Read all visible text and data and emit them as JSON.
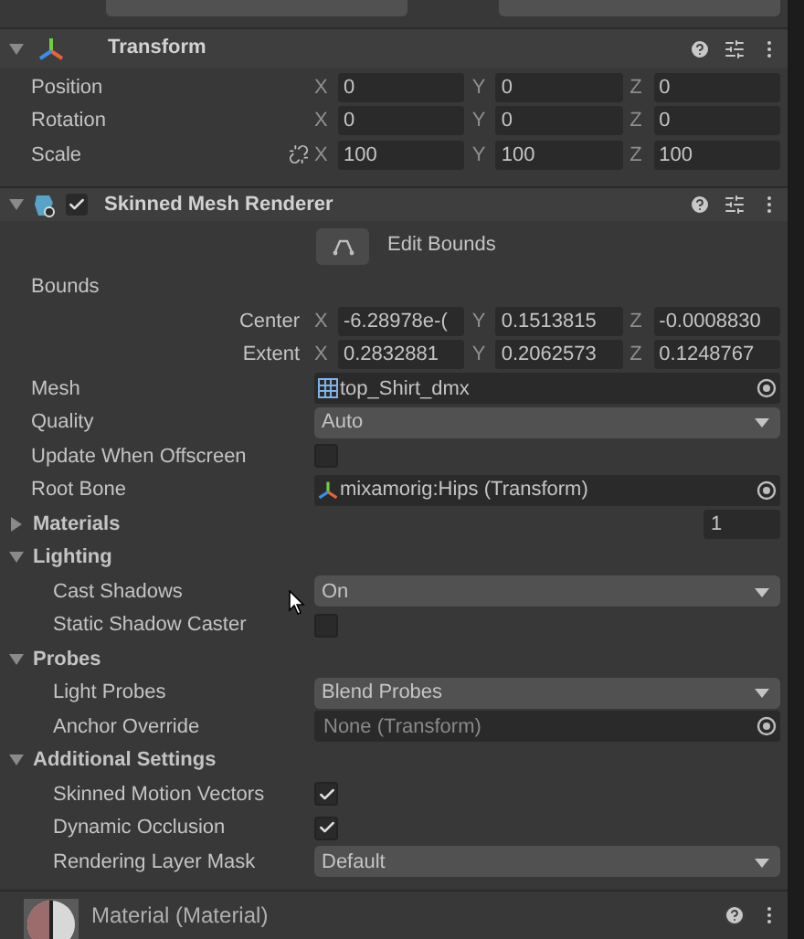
{
  "transform": {
    "title": "Transform",
    "expanded": true,
    "rows": [
      {
        "label": "Position",
        "link": false,
        "fields": [
          {
            "axis": "X",
            "value": "0"
          },
          {
            "axis": "Y",
            "value": "0"
          },
          {
            "axis": "Z",
            "value": "0"
          }
        ]
      },
      {
        "label": "Rotation",
        "link": false,
        "fields": [
          {
            "axis": "X",
            "value": "0"
          },
          {
            "axis": "Y",
            "value": "0"
          },
          {
            "axis": "Z",
            "value": "0"
          }
        ]
      },
      {
        "label": "Scale",
        "link": true,
        "fields": [
          {
            "axis": "X",
            "value": "100"
          },
          {
            "axis": "Y",
            "value": "100"
          },
          {
            "axis": "Z",
            "value": "100"
          }
        ]
      }
    ]
  },
  "renderer": {
    "title": "Skinned Mesh Renderer",
    "expanded": true,
    "enabled": true,
    "edit_button": "Edit Bounds",
    "rows": [
      {
        "kind": "label",
        "label": "Bounds"
      },
      {
        "kind": "vector",
        "label": "Center",
        "fields": [
          {
            "axis": "X",
            "value": "-6.28978e-("
          },
          {
            "axis": "Y",
            "value": "0.1513815"
          },
          {
            "axis": "Z",
            "value": "-0.0008830"
          }
        ]
      },
      {
        "kind": "vector",
        "label": "Extent",
        "fields": [
          {
            "axis": "X",
            "value": "0.2832881"
          },
          {
            "axis": "Y",
            "value": "0.2062573"
          },
          {
            "axis": "Z",
            "value": "0.1248767"
          }
        ]
      },
      {
        "kind": "mesh_object",
        "label": "Mesh",
        "value": "top_Shirt_dmx"
      },
      {
        "kind": "dropdown",
        "label": "Quality",
        "value": "Auto"
      },
      {
        "kind": "checkbox",
        "label": "Update When Offscreen",
        "checked": false
      },
      {
        "kind": "transform_object",
        "label": "Root Bone",
        "value": "mixamorig:Hips (Transform)"
      },
      {
        "kind": "foldout",
        "label": "Materials",
        "expanded": false,
        "count": "1"
      },
      {
        "kind": "foldout",
        "label": "Lighting",
        "expanded": true,
        "children": [
          {
            "kind": "dropdown",
            "label": "Cast Shadows",
            "value": "On"
          },
          {
            "kind": "checkbox",
            "label": "Static Shadow Caster",
            "checked": false
          }
        ]
      },
      {
        "kind": "foldout",
        "label": "Probes",
        "expanded": true,
        "children": [
          {
            "kind": "dropdown",
            "label": "Light Probes",
            "value": "Blend Probes"
          },
          {
            "kind": "empty_object",
            "label": "Anchor Override",
            "value": "None (Transform)"
          }
        ]
      },
      {
        "kind": "foldout",
        "label": "Additional Settings",
        "expanded": true,
        "children": [
          {
            "kind": "checkbox",
            "label": "Skinned Motion Vectors",
            "checked": true
          },
          {
            "kind": "checkbox",
            "label": "Dynamic Occlusion",
            "checked": true
          },
          {
            "kind": "dropdown",
            "label": "Rendering Layer Mask",
            "value": "Default"
          }
        ]
      }
    ]
  },
  "material": {
    "title": "Material (Material)"
  }
}
